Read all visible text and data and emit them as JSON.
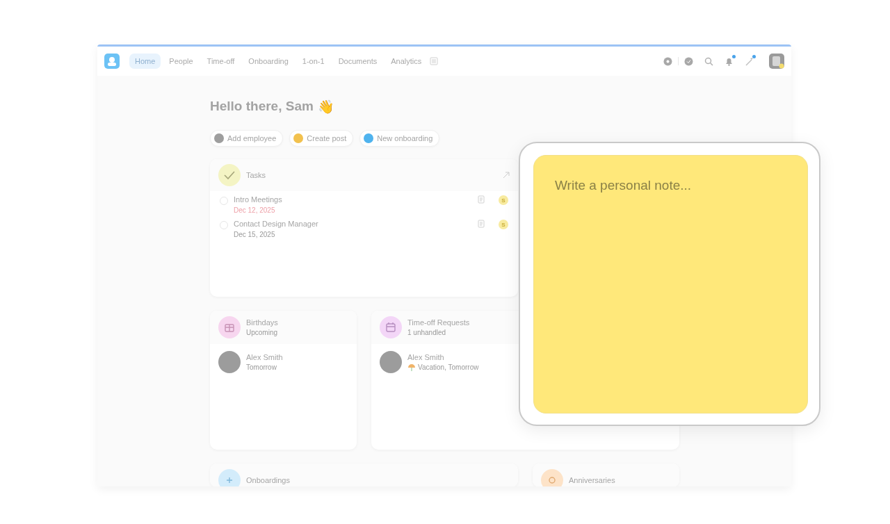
{
  "nav": {
    "items": [
      {
        "label": "Home",
        "selected": true
      },
      {
        "label": "People",
        "selected": false
      },
      {
        "label": "Time-off",
        "selected": false
      },
      {
        "label": "Onboarding",
        "selected": false
      },
      {
        "label": "1-on-1",
        "selected": false
      },
      {
        "label": "Documents",
        "selected": false
      },
      {
        "label": "Analytics",
        "selected": false
      }
    ],
    "notifications_unread": true,
    "assistant_unread": true
  },
  "greeting": "Hello there, Sam",
  "greeting_emoji": "👋",
  "quick_actions": [
    {
      "label": "Add employee",
      "color": "#9e9e9e"
    },
    {
      "label": "Create post",
      "color": "#f2c14e"
    },
    {
      "label": "New onboarding",
      "color": "#4fb3ee"
    }
  ],
  "tasks": {
    "title": "Tasks",
    "items": [
      {
        "title": "Intro Meetings",
        "date": "Dec 12, 2025",
        "overdue": true,
        "checked": false,
        "assignee": "S"
      },
      {
        "title": "Contact Design Manager",
        "date": "Dec 15, 2025",
        "overdue": false,
        "checked": false,
        "assignee": "S"
      }
    ]
  },
  "cards": [
    {
      "kind": "birthdays",
      "title": "Birthdays",
      "subtitle": "Upcoming",
      "color": "#f7d6ef",
      "people": [
        {
          "name": "Alex Smith",
          "detail": "Tomorrow",
          "vacation": false
        }
      ]
    },
    {
      "kind": "timeoff",
      "title": "Time-off Requests",
      "subtitle": "1 unhandled",
      "color": "#f3d6f7",
      "people": [
        {
          "name": "Alex Smith",
          "detail": "Vacation, Tomorrow",
          "vacation": true
        }
      ]
    },
    {
      "kind": "onboardings",
      "title": "Onboardings",
      "color": "#d3ecfb"
    },
    {
      "kind": "anniversaries",
      "title": "Anniversaries",
      "color": "#fde3c8"
    }
  ],
  "note": {
    "placeholder": "Write a personal note..."
  }
}
